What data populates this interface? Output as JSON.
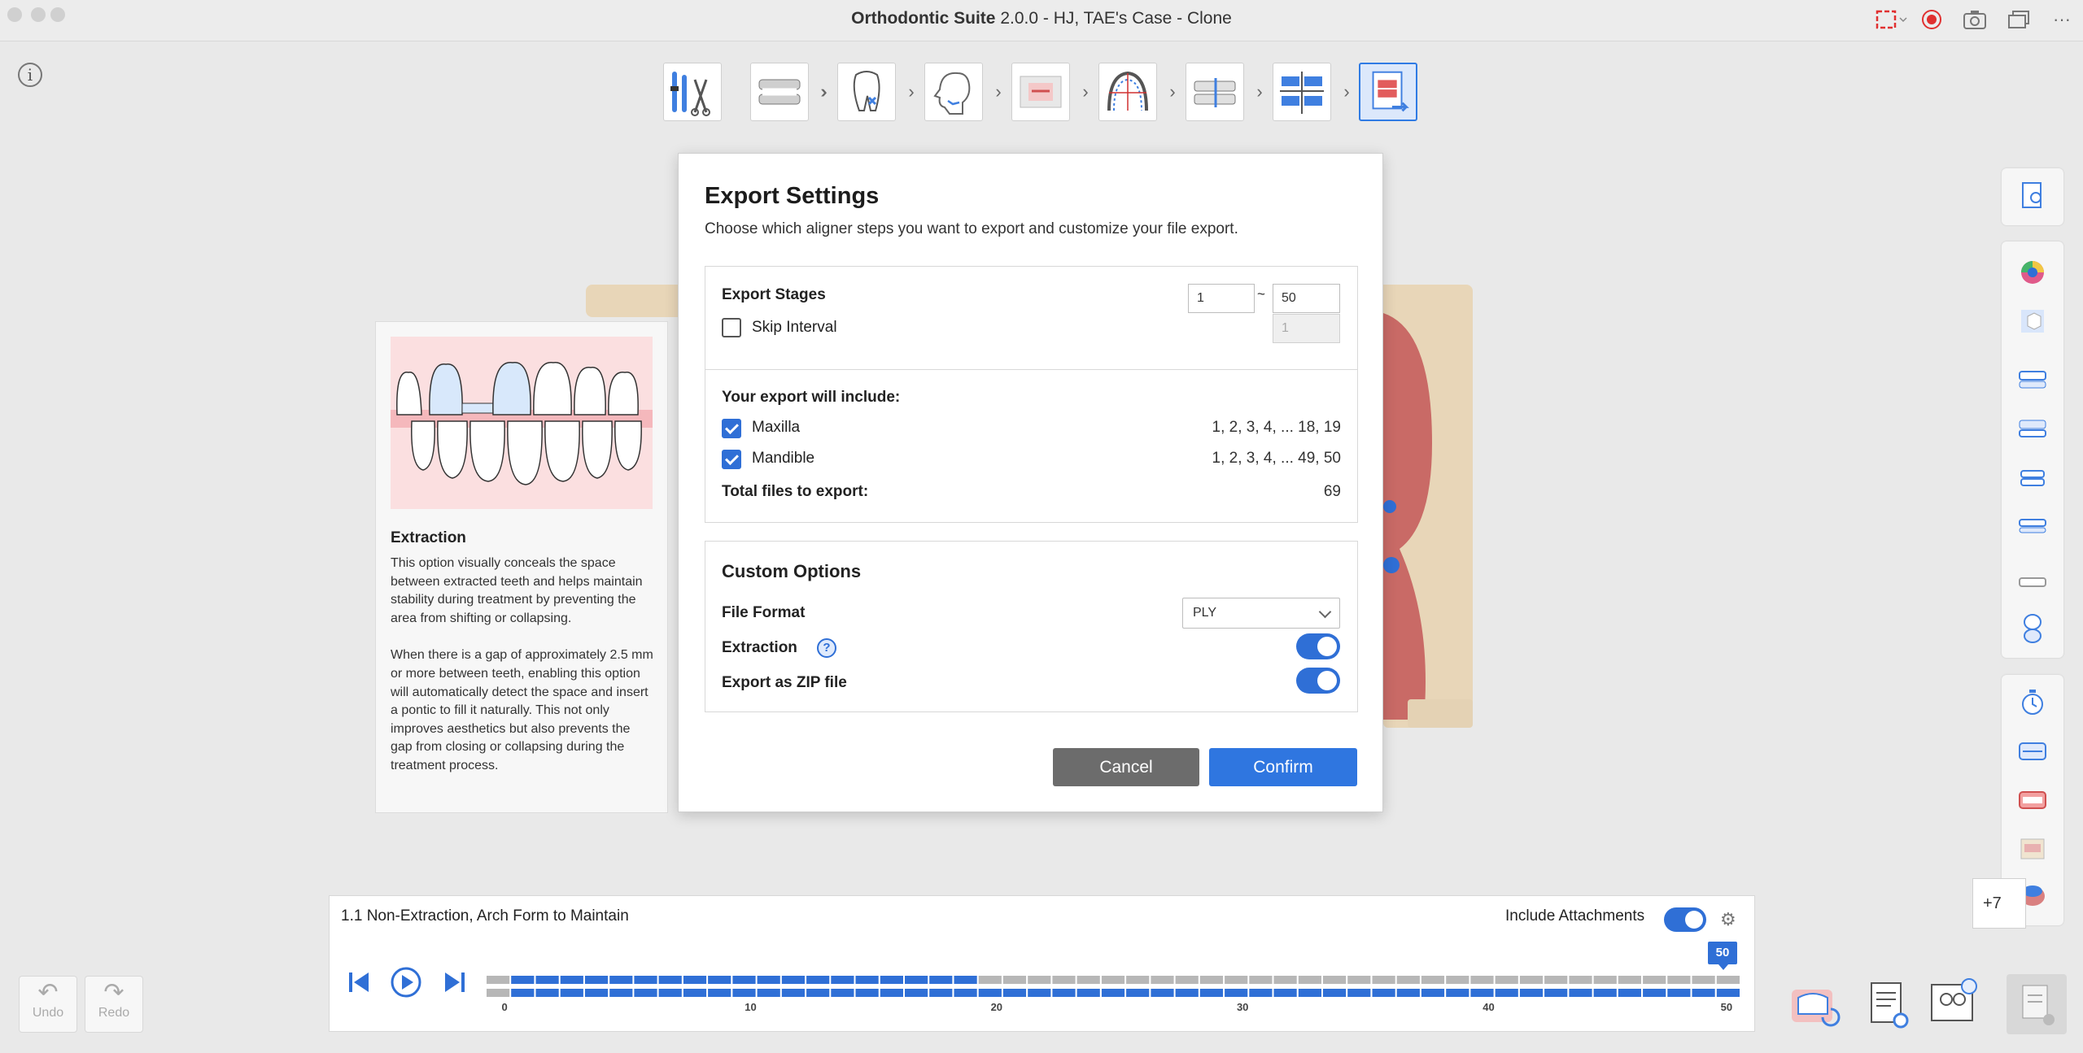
{
  "window": {
    "app_name": "Orthodontic Suite",
    "title_rest": " 2.0.0 - HJ, TAE's Case - Clone",
    "more_icon": "ellipsis-icon"
  },
  "workflow_steps": [
    {
      "name": "tools-step-icon"
    },
    {
      "name": "jaws-step-icon"
    },
    {
      "name": "tooth-step-icon"
    },
    {
      "name": "face-profile-step-icon"
    },
    {
      "name": "photo-step-icon"
    },
    {
      "name": "arch-form-step-icon"
    },
    {
      "name": "bite-step-icon"
    },
    {
      "name": "alignment-step-icon"
    },
    {
      "name": "export-step-icon",
      "active": true
    }
  ],
  "help_panel": {
    "title": "Extraction",
    "paragraph1": "This option visually conceals the space between extracted teeth and helps maintain stability during treatment by preventing the area from shifting or collapsing.",
    "paragraph2": "When there is a gap of approximately 2.5 mm or more between teeth, enabling this option will automatically detect the space and insert a pontic to fill it naturally. This not only improves aesthetics but also prevents the gap from closing or collapsing during the treatment process."
  },
  "dialog": {
    "title": "Export Settings",
    "subtitle": "Choose which aligner steps you want to export and customize your file export.",
    "export_stages_label": "Export Stages",
    "stage_from": "1",
    "stage_separator": "~",
    "stage_to": "50",
    "skip_interval_label": "Skip Interval",
    "skip_interval_checked": false,
    "skip_interval_value": "1",
    "include_heading": "Your export will include:",
    "maxilla_label": "Maxilla",
    "maxilla_checked": true,
    "maxilla_stages": "1, 2, 3, 4, ... 18, 19",
    "mandible_label": "Mandible",
    "mandible_checked": true,
    "mandible_stages": "1, 2, 3, 4, ... 49, 50",
    "total_label": "Total files to export:",
    "total_value": "69",
    "custom_options_heading": "Custom Options",
    "file_format_label": "File Format",
    "file_format_value": "PLY",
    "extraction_label": "Extraction",
    "extraction_help": "?",
    "extraction_on": true,
    "zip_label": "Export as ZIP file",
    "zip_on": true,
    "cancel_label": "Cancel",
    "confirm_label": "Confirm"
  },
  "timeline": {
    "plan_label": "1.1 Non-Extraction, Arch Form to Maintain",
    "attachments_label": "Include Attachments",
    "attachments_on": true,
    "current_stage": "50",
    "maxilla_last_stage": 19,
    "mandible_last_stage": 50,
    "total_stages": 50,
    "ticks": [
      "0",
      "10",
      "20",
      "30",
      "40",
      "50"
    ]
  },
  "history": {
    "undo_label": "Undo",
    "redo_label": "Redo"
  },
  "overflow_tab": "+7",
  "colors": {
    "accent": "#2f6fd6",
    "track_inactive": "#b7b7b7",
    "gum": "#c96a66",
    "base": "#e8d6b8"
  }
}
